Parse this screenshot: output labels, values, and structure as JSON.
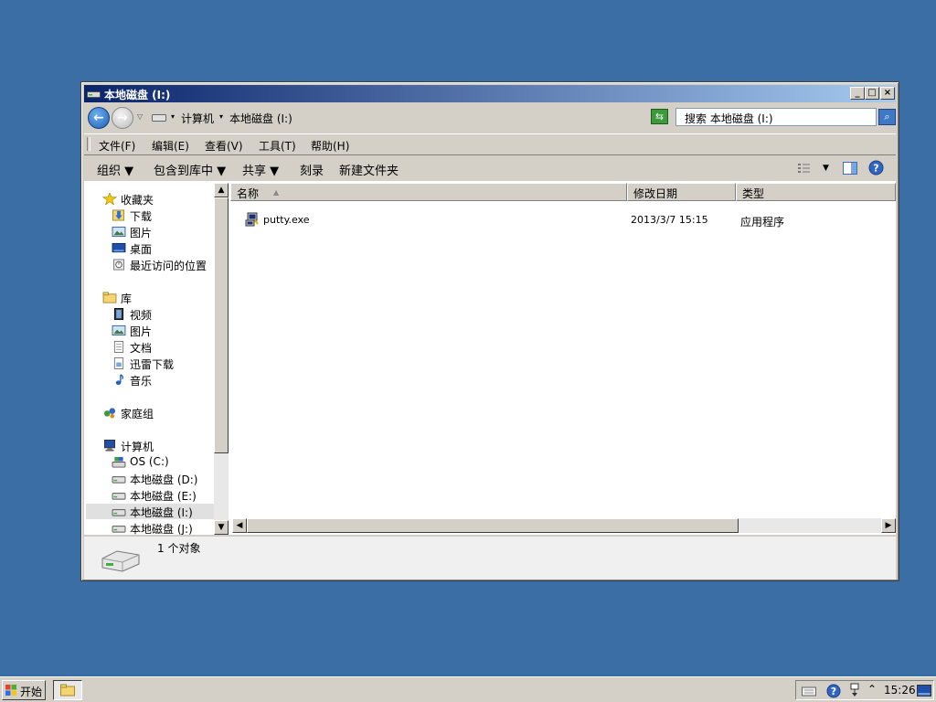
{
  "window": {
    "title": "本地磁盘 (I:)",
    "minimize_label": "_",
    "maximize_label": "□",
    "close_label": "×"
  },
  "address": {
    "crumbs": [
      "计算机",
      "本地磁盘 (I:)"
    ],
    "search_placeholder": "搜索 本地磁盘 (I:)"
  },
  "menu": [
    "文件(F)",
    "编辑(E)",
    "查看(V)",
    "工具(T)",
    "帮助(H)"
  ],
  "command_bar": {
    "organize": "组织 ▼",
    "include_library": "包含到库中 ▼",
    "share": "共享 ▼",
    "burn": "刻录",
    "new_folder": "新建文件夹"
  },
  "nav_tree": {
    "favorites": {
      "label": "收藏夹",
      "items": [
        "下载",
        "图片",
        "桌面",
        "最近访问的位置"
      ]
    },
    "libraries": {
      "label": "库",
      "items": [
        "视频",
        "图片",
        "文档",
        "迅雷下载",
        "音乐"
      ]
    },
    "homegroup": "家庭组",
    "computer": {
      "label": "计算机",
      "items": [
        "OS (C:)",
        "本地磁盘 (D:)",
        "本地磁盘 (E:)",
        "本地磁盘 (I:)",
        "本地磁盘 (J:)"
      ]
    }
  },
  "columns": [
    "名称",
    "修改日期",
    "类型"
  ],
  "files": [
    {
      "name": "putty.exe",
      "modified": "2013/3/7 15:15",
      "type": "应用程序"
    }
  ],
  "details_pane": {
    "count": "1 个对象"
  },
  "taskbar": {
    "start": "开始",
    "clock": "15:26"
  },
  "colors": {
    "desktop": "#3a6ea5",
    "title_start": "#0a246a",
    "title_end": "#a6caf0"
  }
}
